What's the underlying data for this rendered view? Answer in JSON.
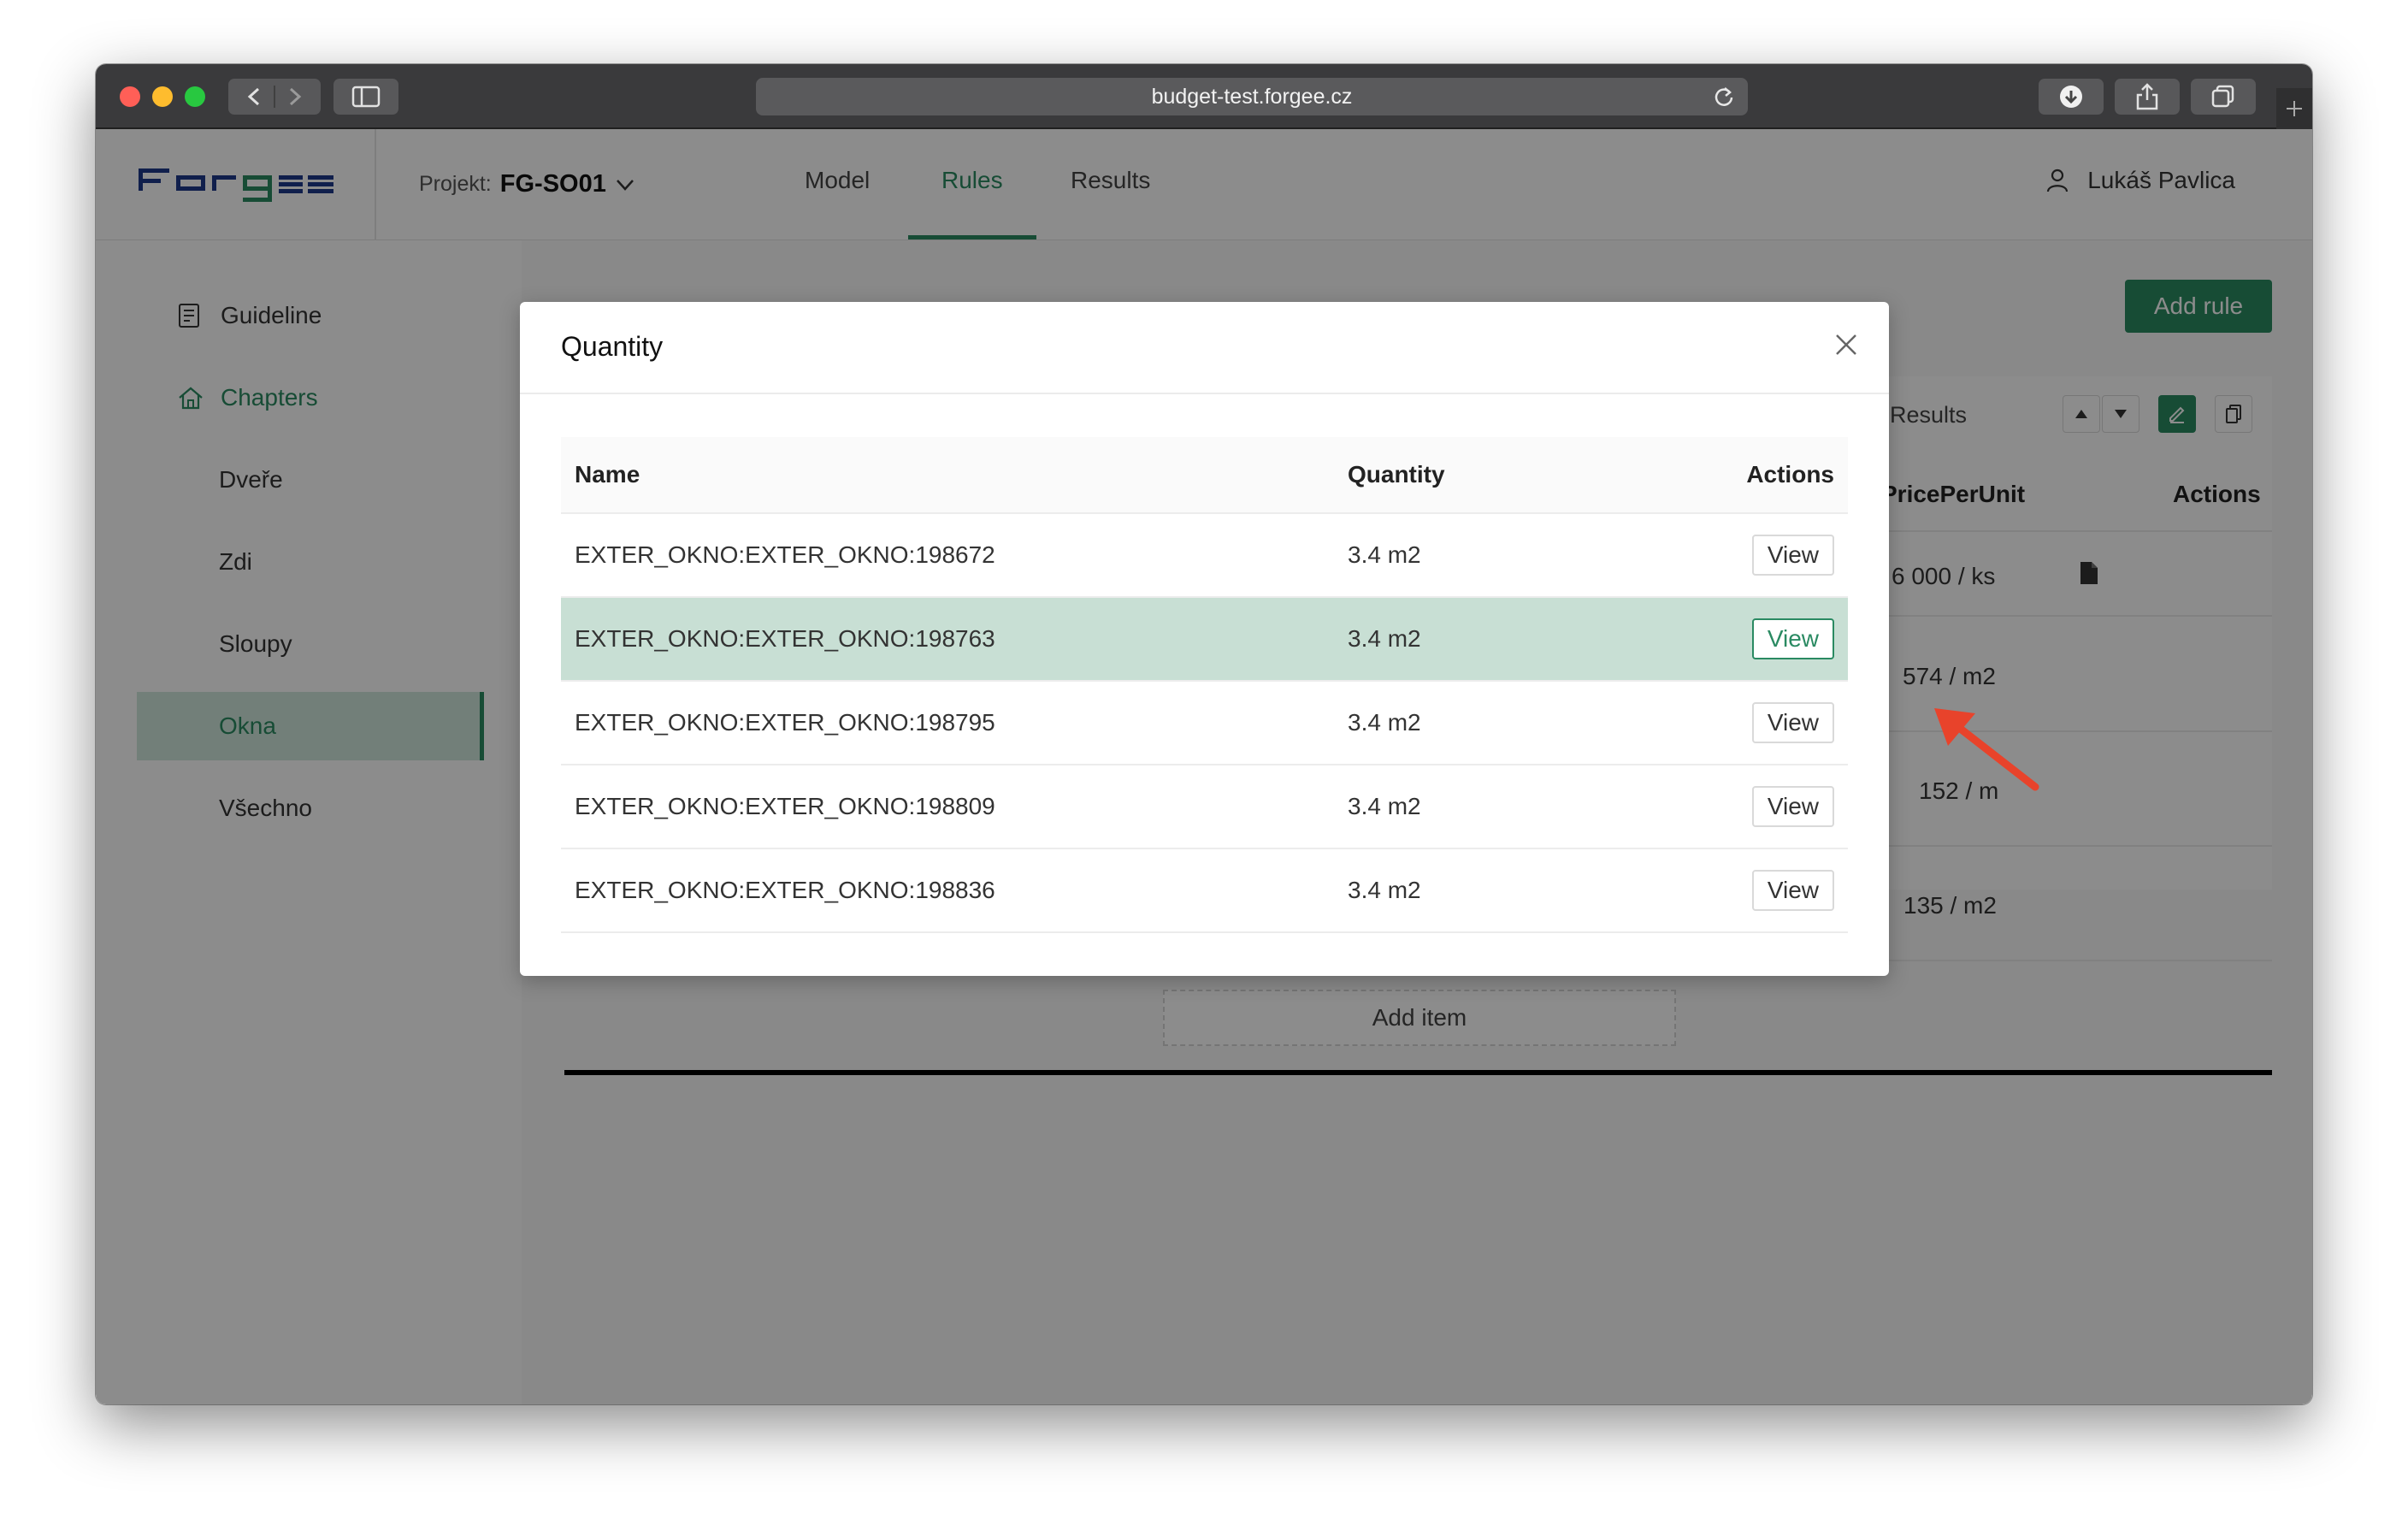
{
  "browser": {
    "url": "budget-test.forgee.cz",
    "traffic_lights": [
      "#ff5f57",
      "#febc2e",
      "#28c840"
    ]
  },
  "header": {
    "logo": "forgee",
    "project_label": "Projekt:",
    "project_name": "FG-SO01",
    "nav": [
      "Model",
      "Rules",
      "Results"
    ],
    "active_nav": "Rules",
    "user_name": "Lukáš Pavlica"
  },
  "sidebar": {
    "items": [
      {
        "label": "Guideline",
        "icon": "document-icon"
      },
      {
        "label": "Chapters",
        "icon": "home-icon"
      },
      {
        "label": "Dveře"
      },
      {
        "label": "Zdi"
      },
      {
        "label": "Sloupy"
      },
      {
        "label": "Okna"
      },
      {
        "label": "Všechno"
      }
    ],
    "active": "Okna"
  },
  "background": {
    "add_rule": "Add rule",
    "results_label": "Results",
    "columns": [
      "PricePerUnit",
      "Actions"
    ],
    "price_cells": [
      "6 000  /  ks",
      "574  /  m2",
      "152  /  m",
      "135  /  m2"
    ],
    "add_item": "Add item"
  },
  "modal": {
    "title": "Quantity",
    "columns": {
      "name": "Name",
      "quantity": "Quantity",
      "actions": "Actions"
    },
    "view_label": "View",
    "rows": [
      {
        "name": "EXTER_OKNO:EXTER_OKNO:198672",
        "quantity": "3.4 m2"
      },
      {
        "name": "EXTER_OKNO:EXTER_OKNO:198763",
        "quantity": "3.4 m2"
      },
      {
        "name": "EXTER_OKNO:EXTER_OKNO:198795",
        "quantity": "3.4 m2"
      },
      {
        "name": "EXTER_OKNO:EXTER_OKNO:198809",
        "quantity": "3.4 m2"
      },
      {
        "name": "EXTER_OKNO:EXTER_OKNO:198836",
        "quantity": "3.4 m2"
      }
    ],
    "selected_row": 1
  },
  "colors": {
    "accent": "#2a8a62",
    "selected_row": "#c8dfd4",
    "annotation_arrow": "#e8432b"
  }
}
